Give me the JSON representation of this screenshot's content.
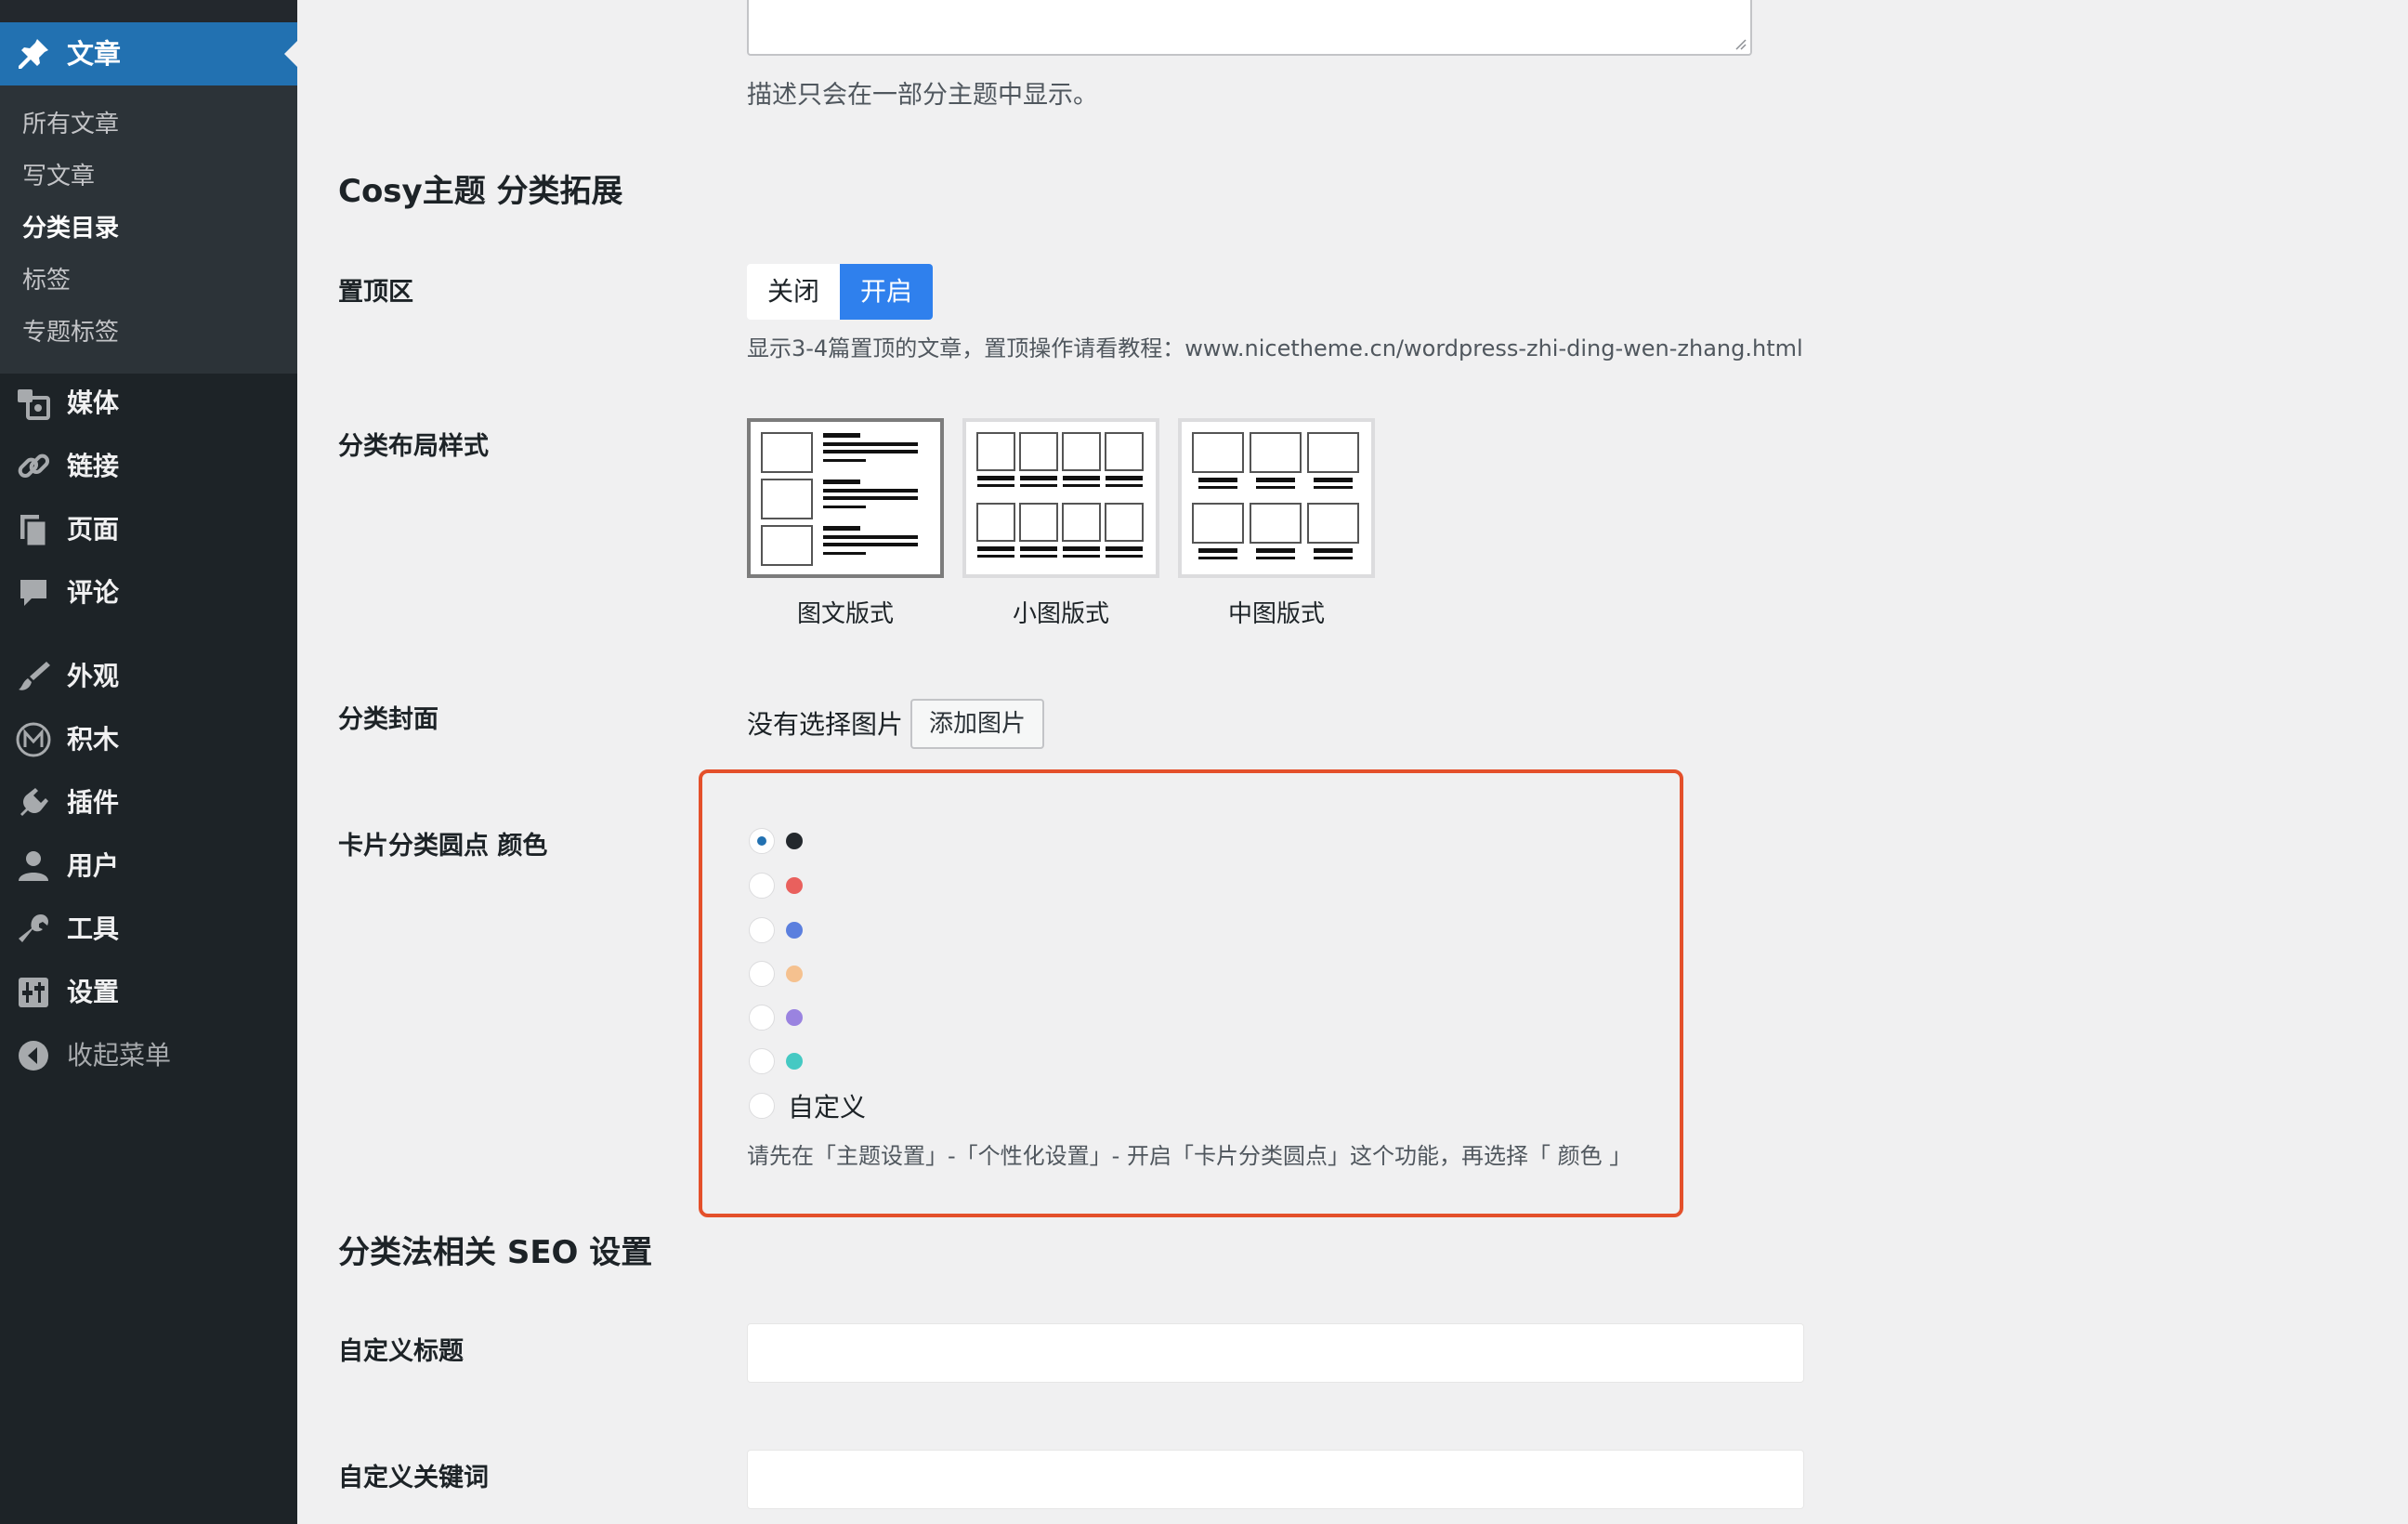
{
  "sidebar": {
    "active": {
      "label": "文章",
      "icon": "pin-icon"
    },
    "submenu": [
      {
        "label": "所有文章",
        "current": false
      },
      {
        "label": "写文章",
        "current": false
      },
      {
        "label": "分类目录",
        "current": true
      },
      {
        "label": "标签",
        "current": false
      },
      {
        "label": "专题标签",
        "current": false
      }
    ],
    "menu": [
      {
        "label": "媒体",
        "icon": "media-icon"
      },
      {
        "label": "链接",
        "icon": "link-icon"
      },
      {
        "label": "页面",
        "icon": "pages-icon"
      },
      {
        "label": "评论",
        "icon": "comment-icon"
      },
      {
        "label": "外观",
        "icon": "appearance-icon"
      },
      {
        "label": "积木",
        "icon": "blocks-icon"
      },
      {
        "label": "插件",
        "icon": "plugin-icon"
      },
      {
        "label": "用户",
        "icon": "user-icon"
      },
      {
        "label": "工具",
        "icon": "wrench-icon"
      },
      {
        "label": "设置",
        "icon": "settings-icon"
      },
      {
        "label": "收起菜单",
        "icon": "collapse-icon"
      }
    ]
  },
  "description_help": "描述只会在一部分主题中显示。",
  "cosy": {
    "section_title": "Cosy主题 分类拓展",
    "top_area": {
      "label": "置顶区",
      "options": [
        "关闭",
        "开启"
      ],
      "selected": "开启",
      "help": "显示3-4篇置顶的文章，置顶操作请看教程：www.nicetheme.cn/wordpress-zhi-ding-wen-zhang.html"
    },
    "layout": {
      "label": "分类布局样式",
      "options": [
        "图文版式",
        "小图版式",
        "中图版式"
      ],
      "selected": "图文版式"
    },
    "cover": {
      "label": "分类封面",
      "status": "没有选择图片",
      "button": "添加图片"
    },
    "dot_color": {
      "label": "卡片分类圆点 颜色",
      "options": [
        {
          "color": "#23282d",
          "checked": true
        },
        {
          "color": "#e9605d",
          "checked": false
        },
        {
          "color": "#5b7fde",
          "checked": false
        },
        {
          "color": "#f5c18f",
          "checked": false
        },
        {
          "color": "#9a83e0",
          "checked": false
        },
        {
          "color": "#45c9c3",
          "checked": false
        }
      ],
      "custom_label": "自定义",
      "help": "请先在「主题设置」-「个性化设置」- 开启「卡片分类圆点」这个功能，再选择「 颜色 」",
      "highlight_color": "#e4502b"
    }
  },
  "seo": {
    "section_title": "分类法相关 SEO 设置",
    "fields": [
      {
        "label": "自定义标题",
        "value": ""
      },
      {
        "label": "自定义关键词",
        "value": ""
      }
    ]
  }
}
